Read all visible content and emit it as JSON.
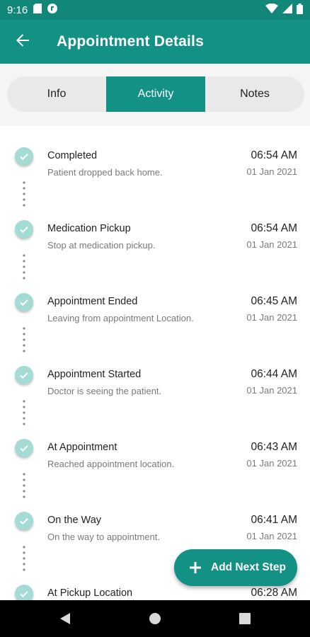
{
  "status_bar": {
    "time": "9:16",
    "icons": [
      "sd-card-icon",
      "app-notification-icon",
      "wifi-icon",
      "signal-icon",
      "battery-icon"
    ]
  },
  "header": {
    "title": "Appointment Details",
    "back_icon": "arrow-back-icon"
  },
  "tabs": [
    {
      "label": "Info",
      "active": false
    },
    {
      "label": "Activity",
      "active": true
    },
    {
      "label": "Notes",
      "active": false
    }
  ],
  "activity": [
    {
      "title": "Completed",
      "description": "Patient dropped back home.",
      "time": "06:54 AM",
      "date": "01 Jan 2021"
    },
    {
      "title": "Medication Pickup",
      "description": "Stop at medication pickup.",
      "time": "06:54 AM",
      "date": "01 Jan 2021"
    },
    {
      "title": "Appointment Ended",
      "description": "Leaving from appointment Location.",
      "time": "06:45 AM",
      "date": "01 Jan 2021"
    },
    {
      "title": "Appointment Started",
      "description": "Doctor is seeing the patient.",
      "time": "06:44 AM",
      "date": "01 Jan 2021"
    },
    {
      "title": "At Appointment",
      "description": "Reached appointment location.",
      "time": "06:43 AM",
      "date": "01 Jan 2021"
    },
    {
      "title": "On the Way",
      "description": "On the way to appointment.",
      "time": "06:41 AM",
      "date": "01 Jan 2021"
    },
    {
      "title": "At Pickup Location",
      "description": "",
      "time": "06:28 AM",
      "date": ""
    }
  ],
  "fab": {
    "label": "Add Next Step",
    "icon": "plus-icon"
  },
  "colors": {
    "primary": "#139185",
    "status_bar": "#11877a",
    "check_bg": "#a4dcd5"
  }
}
